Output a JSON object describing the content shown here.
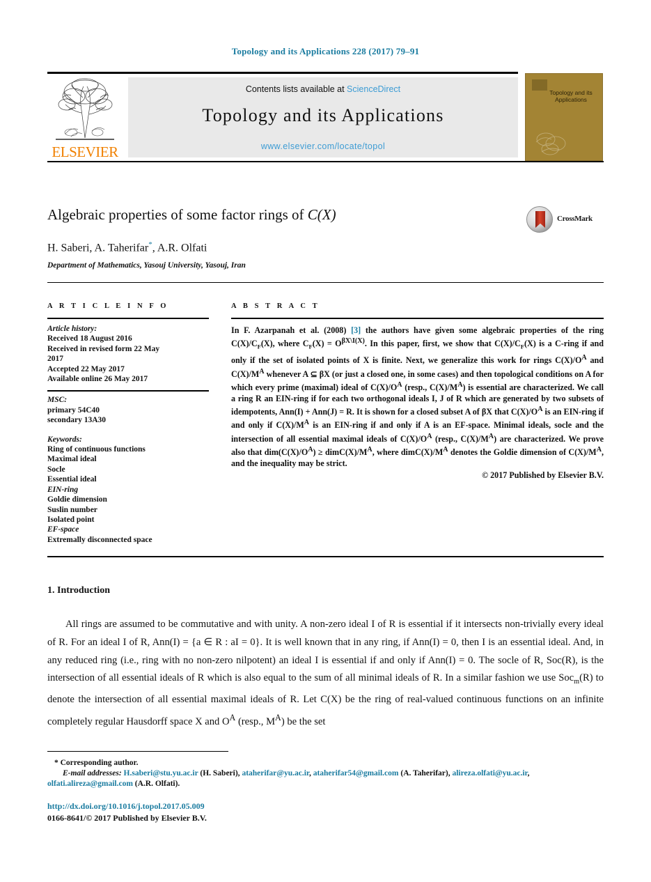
{
  "running_head": "Topology and its Applications 228 (2017) 79–91",
  "masthead": {
    "publisher_name": "ELSEVIER",
    "contents_prefix": "Contents lists available at ",
    "sciencedirect_link": "ScienceDirect",
    "journal_name": "Topology and its Applications",
    "journal_url": "www.elsevier.com/locate/topol",
    "cover_title": "Topology and its Applications"
  },
  "article": {
    "title_plain": "Algebraic properties of some factor rings of ",
    "title_math": "C(X)",
    "authors": "H. Saberi, A. Taherifar",
    "authors_tail": ", A.R. Olfati",
    "corresponding_marker": "*",
    "affiliation": "Department of Mathematics, Yasouj University, Yasouj, Iran",
    "crossmark_label": "CrossMark"
  },
  "info": {
    "heading": "A R T I C L E   I N F O",
    "history_label": "Article history:",
    "history_lines": [
      "Received 18 August 2016",
      "Received in revised form 22 May",
      "2017",
      "Accepted 22 May 2017",
      "Available online 26 May 2017"
    ],
    "msc_label": "MSC:",
    "msc_lines": [
      "primary 54C40",
      "secondary 13A30"
    ],
    "keywords_label": "Keywords:",
    "keywords": [
      "Ring of continuous functions",
      "Maximal ideal",
      "Socle",
      "Essential ideal",
      "EIN-ring",
      "Goldie dimension",
      "Suslin number",
      "Isolated point",
      "EF-space",
      "Extremally disconnected space"
    ]
  },
  "abstract": {
    "heading": "A B S T R A C T",
    "reference_number": "[3]",
    "text_part1": "In F. Azarpanah et al. (2008) ",
    "text_part2": " the authors have given some algebraic properties of the ring C(X)/C<sub>F</sub>(X), where C<sub>F</sub>(X) = O<sup>βX\\I(X)</sup>. In this paper, first, we show that C(X)/C<sub>F</sub>(X) is a C-ring if and only if the set of isolated points of X is finite. Next, we generalize this work for rings C(X)/O<sup>A</sup> and C(X)/M<sup>A</sup> whenever A ⊆ βX (or just a closed one, in some cases) and then topological conditions on A for which every prime (maximal) ideal of C(X)/O<sup>A</sup> (resp., C(X)/M<sup>A</sup>) is essential are characterized. We call a ring R an EIN-ring if for each two orthogonal ideals I, J of R which are generated by two subsets of idempotents, Ann(I) + Ann(J) = R. It is shown for a closed subset A of βX that C(X)/O<sup>A</sup> is an EIN-ring if and only if C(X)/M<sup>A</sup> is an EIN-ring if and only if A is an EF-space. Minimal ideals, socle and the intersection of all essential maximal ideals of C(X)/O<sup>A</sup> (resp., C(X)/M<sup>A</sup>) are characterized. We prove also that dim(C(X)/O<sup>A</sup>) ≥ dimC(X)/M<sup>A</sup>, where dimC(X)/M<sup>A</sup> denotes the Goldie dimension of C(X)/M<sup>A</sup>, and the inequality may be strict.",
    "copyright": "© 2017 Published by Elsevier B.V."
  },
  "body": {
    "section_number_title": "1. Introduction",
    "paragraph": "All rings are assumed to be commutative and with unity. A non-zero ideal I of R is essential if it intersects non-trivially every ideal of R. For an ideal I of R, Ann(I) = {a ∈ R : aI = 0}. It is well known that in any ring, if Ann(I) = 0, then I is an essential ideal. And, in any reduced ring (i.e., ring with no non-zero nilpotent) an ideal I is essential if and only if Ann(I) = 0. The socle of R, Soc(R), is the intersection of all essential ideals of R which is also equal to the sum of all minimal ideals of R. In a similar fashion we use Soc<sub>m</sub>(R) to denote the intersection of all essential maximal ideals of R. Let C(X) be the ring of real-valued continuous functions on an infinite completely regular Hausdorff space X and O<sup>A</sup> (resp., M<sup>A</sup>) be the set"
  },
  "footnote": {
    "corresponding_author": "* Corresponding author.",
    "email_label": "E-mail addresses:",
    "email_1": "H.saberi@stu.yu.ac.ir",
    "email_1_owner": "(H. Saberi),",
    "email_2": "ataherifar@yu.ac.ir",
    "email_3": "ataherifar54@gmail.com",
    "email_23_owner": "(A. Taherifar),",
    "email_4": "alireza.olfati@yu.ac.ir",
    "email_5": "olfati.alireza@gmail.com",
    "email_45_owner": "(A.R. Olfati)."
  },
  "doi": "http://dx.doi.org/10.1016/j.topol.2017.05.009",
  "issn_line": "0166-8641/© 2017 Published by Elsevier B.V.",
  "colors": {
    "link_teal": "#1b7ca0",
    "link_blue": "#3d9cd4",
    "elsevier_orange": "#f08000",
    "cover_gold": "#a38434",
    "panel_gray": "#e9e9e9"
  }
}
